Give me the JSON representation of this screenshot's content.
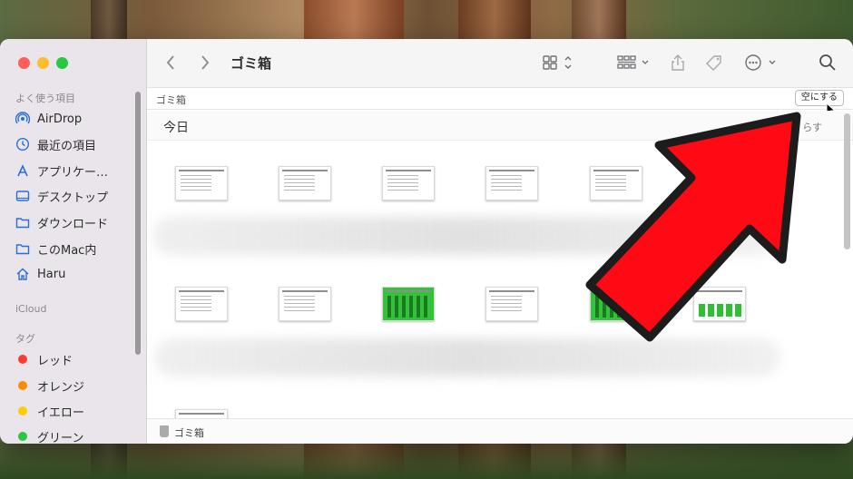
{
  "window": {
    "title": "ゴミ箱"
  },
  "sidebar": {
    "sections": {
      "favorites": "よく使う項目",
      "icloud": "iCloud",
      "tags": "タグ"
    },
    "items": [
      {
        "label": "AirDrop",
        "icon": "airdrop-icon"
      },
      {
        "label": "最近の項目",
        "icon": "clock-icon"
      },
      {
        "label": "アプリケー…",
        "icon": "applications-icon"
      },
      {
        "label": "デスクトップ",
        "icon": "desktop-icon"
      },
      {
        "label": "ダウンロード",
        "icon": "folder-icon"
      },
      {
        "label": "このMac内",
        "icon": "folder-icon"
      },
      {
        "label": "Haru",
        "icon": "home-icon"
      }
    ],
    "tags": [
      {
        "label": "レッド",
        "color": "#ff3b30"
      },
      {
        "label": "オレンジ",
        "color": "#ff8a00"
      },
      {
        "label": "イエロー",
        "color": "#ffcc00"
      },
      {
        "label": "グリーン",
        "color": "#28c840"
      }
    ]
  },
  "toolbar": {
    "title": "ゴミ箱",
    "icons": [
      "back-icon",
      "forward-icon",
      "grid-view-icon",
      "group-icon",
      "share-icon",
      "tag-icon",
      "more-icon",
      "search-icon"
    ]
  },
  "pathbar": {
    "label": "ゴミ箱",
    "empty_button": "空にする"
  },
  "section": {
    "title": "今日",
    "more": "らす"
  },
  "statusbar": {
    "label": "ゴミ箱"
  },
  "annotation": {
    "arrow_color": "#ff0a14"
  }
}
